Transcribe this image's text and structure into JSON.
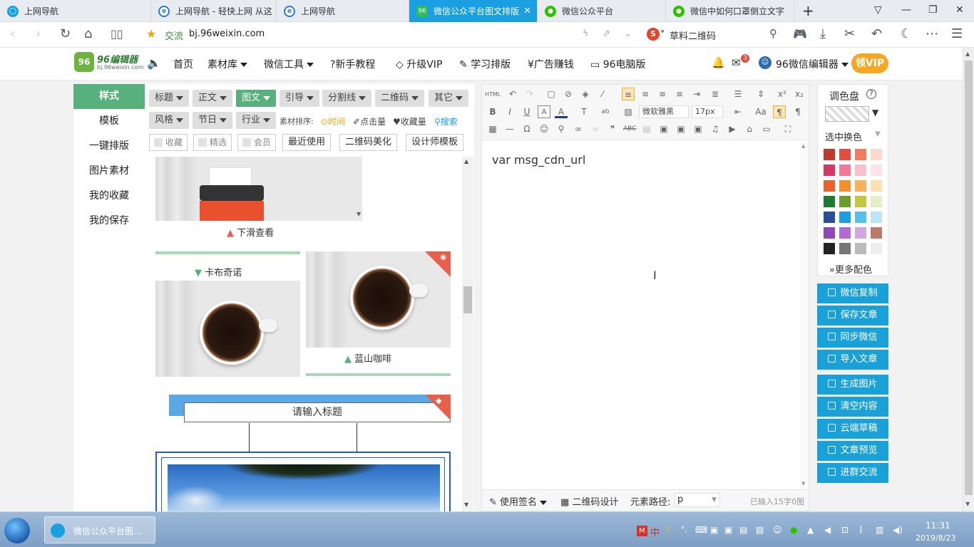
{
  "browser": {
    "tabs": [
      {
        "label": "上网导航",
        "icon": "browser-home-icon"
      },
      {
        "label": "上网导航 - 轻快上网 从这",
        "icon": "ie-icon"
      },
      {
        "label": "上网导航",
        "icon": "ie-icon"
      },
      {
        "label": "微信公众平台图文排版工",
        "icon": "96-icon",
        "active": true
      },
      {
        "label": "微信公众平台",
        "icon": "wechat-icon"
      },
      {
        "label": "微信中如何口罩倒立文字",
        "icon": "wechat-icon"
      }
    ],
    "new_tab": "+",
    "address": {
      "site_label": "交流",
      "url": "bj.96weixin.com"
    },
    "search": {
      "engine_label": "S",
      "placeholder": "草料二维码"
    }
  },
  "site": {
    "logo_text": "96编辑器",
    "logo_sub": "bj.96weixin.com",
    "nav": [
      {
        "label": "首页",
        "dropdown": false
      },
      {
        "label": "素材库",
        "dropdown": true
      },
      {
        "label": "微信工具",
        "dropdown": true
      },
      {
        "label": "?新手教程",
        "dropdown": false
      },
      {
        "label": "升级VIP",
        "dropdown": false
      },
      {
        "label": "学习排版",
        "dropdown": false
      },
      {
        "label": "¥广告赚钱",
        "dropdown": false
      },
      {
        "label": "96电脑版",
        "dropdown": false
      }
    ],
    "mail_badge": "3",
    "user_label": "96微信编辑器",
    "vip_badge": "领VIP"
  },
  "left_menu": [
    "样式",
    "模板",
    "一键排版",
    "图片素材",
    "我的收藏",
    "我的保存"
  ],
  "material": {
    "row1": [
      "标题",
      "正文",
      "图文",
      "引导",
      "分割线",
      "二维码",
      "其它"
    ],
    "row2": [
      "风格",
      "节日",
      "行业"
    ],
    "sort_label": "素材排序:",
    "sort_options": [
      "时间",
      "点击量",
      "收藏量"
    ],
    "search_label": "搜索",
    "filters": [
      "收藏",
      "精选",
      "会员"
    ],
    "buttons": [
      "最近使用",
      "二维码美化",
      "设计师模板"
    ],
    "items": {
      "scroll_hint": "下滑查看",
      "left_caption": "卡布奇诺",
      "right_caption": "蓝山咖啡",
      "title_placeholder": "请输入标题"
    }
  },
  "editor": {
    "font_family": "微软雅黑",
    "font_size": "17px",
    "html_label": "HTML",
    "content": "var msg_cdn_url",
    "footer": {
      "signature": "使用签名",
      "qrcode": "二维码设计",
      "path_label": "元素路径:",
      "path_value": "p",
      "counter": "已输入15字0图"
    }
  },
  "palette": {
    "title": "调色盘",
    "select_label": "选中换色",
    "more_label": "更多配色",
    "swatches": [
      [
        "#c0392b",
        "#e74c3c",
        "#f07b5f",
        "#fbd9cd"
      ],
      [
        "#d63865",
        "#f17899",
        "#f9c1d0",
        "#fde3ea"
      ],
      [
        "#e8632a",
        "#f5902d",
        "#f9b05a",
        "#fde1b3"
      ],
      [
        "#1e7b34",
        "#6e9d2a",
        "#c5c73a",
        "#e4edc6"
      ],
      [
        "#2b4e9b",
        "#1a9fe0",
        "#55c0ef",
        "#bde5f9"
      ],
      [
        "#8e4ab5",
        "#b06cd2",
        "#d3a6e3",
        "#c07a6a"
      ],
      [
        "#222222",
        "#777777",
        "#bbbbbb",
        "#eeeeee"
      ]
    ],
    "actions": [
      "微信复制",
      "保存文章",
      "同步微信",
      "导入文章",
      "生成图片",
      "清空内容",
      "云端草稿",
      "文章预览",
      "进群交流"
    ]
  },
  "taskbar": {
    "app_label": "微信公众平台图...",
    "ime": "中",
    "time": "11:31",
    "date": "2019/8/23"
  },
  "colors": {
    "tab_active": "#1a9fe0",
    "green": "#58b07c",
    "blue_btn": "#1aa1d8"
  }
}
